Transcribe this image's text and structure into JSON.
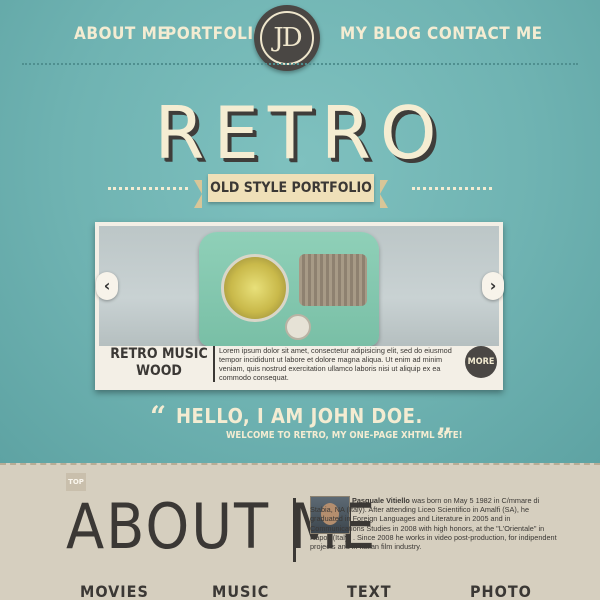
{
  "nav": {
    "items": [
      {
        "label": "ABOUT ME"
      },
      {
        "label": "PORTFOLIO"
      },
      {
        "label": "MY BLOG"
      },
      {
        "label": "CONTACT ME"
      }
    ],
    "logo_text": "JD"
  },
  "hero": {
    "title": "RETRO",
    "ribbon": "OLD STYLE PORTFOLIO"
  },
  "slider": {
    "title_line1": "RETRO MUSIC",
    "title_line2": "WOOD",
    "text": "Lorem ipsum dolor sit amet, consectetur adipisicing elit, sed do eiusmod tempor incididunt ut labore et dolore magna aliqua. Ut enim ad minim veniam, quis nostrud exercitation ullamco laboris nisi ut aliquip ex ea commodo consequat.",
    "more_label": "MORE",
    "prev_icon": "‹",
    "next_icon": "›"
  },
  "greeting": {
    "open_quote": "“",
    "hello": "HELLO, I AM JOHN DOE.",
    "welcome": "WELCOME TO RETRO, MY ONE-PAGE XHTML SITE!",
    "close_quote": "”"
  },
  "about": {
    "top_label": "TOP",
    "heading": "ABOUT ME",
    "bio_name": "Pasquale Vitiello",
    "bio_text": " was born on May 5 1982 in C/mmare di Stabia, NA (Italy). After attending Liceo Scientifico in Amalfi (SA), he graduated in Foreign Languages and Literature in 2005 and in Communications Studies in 2008 with high honors, at the \"L'Orientale\" in Napoli (Italy) . Since 2008 he works in video post-production, for indipendent projects and in Italian film industry."
  },
  "sections": [
    {
      "label": "MOVIES"
    },
    {
      "label": "MUSIC"
    },
    {
      "label": "TEXT"
    },
    {
      "label": "PHOTO"
    }
  ]
}
